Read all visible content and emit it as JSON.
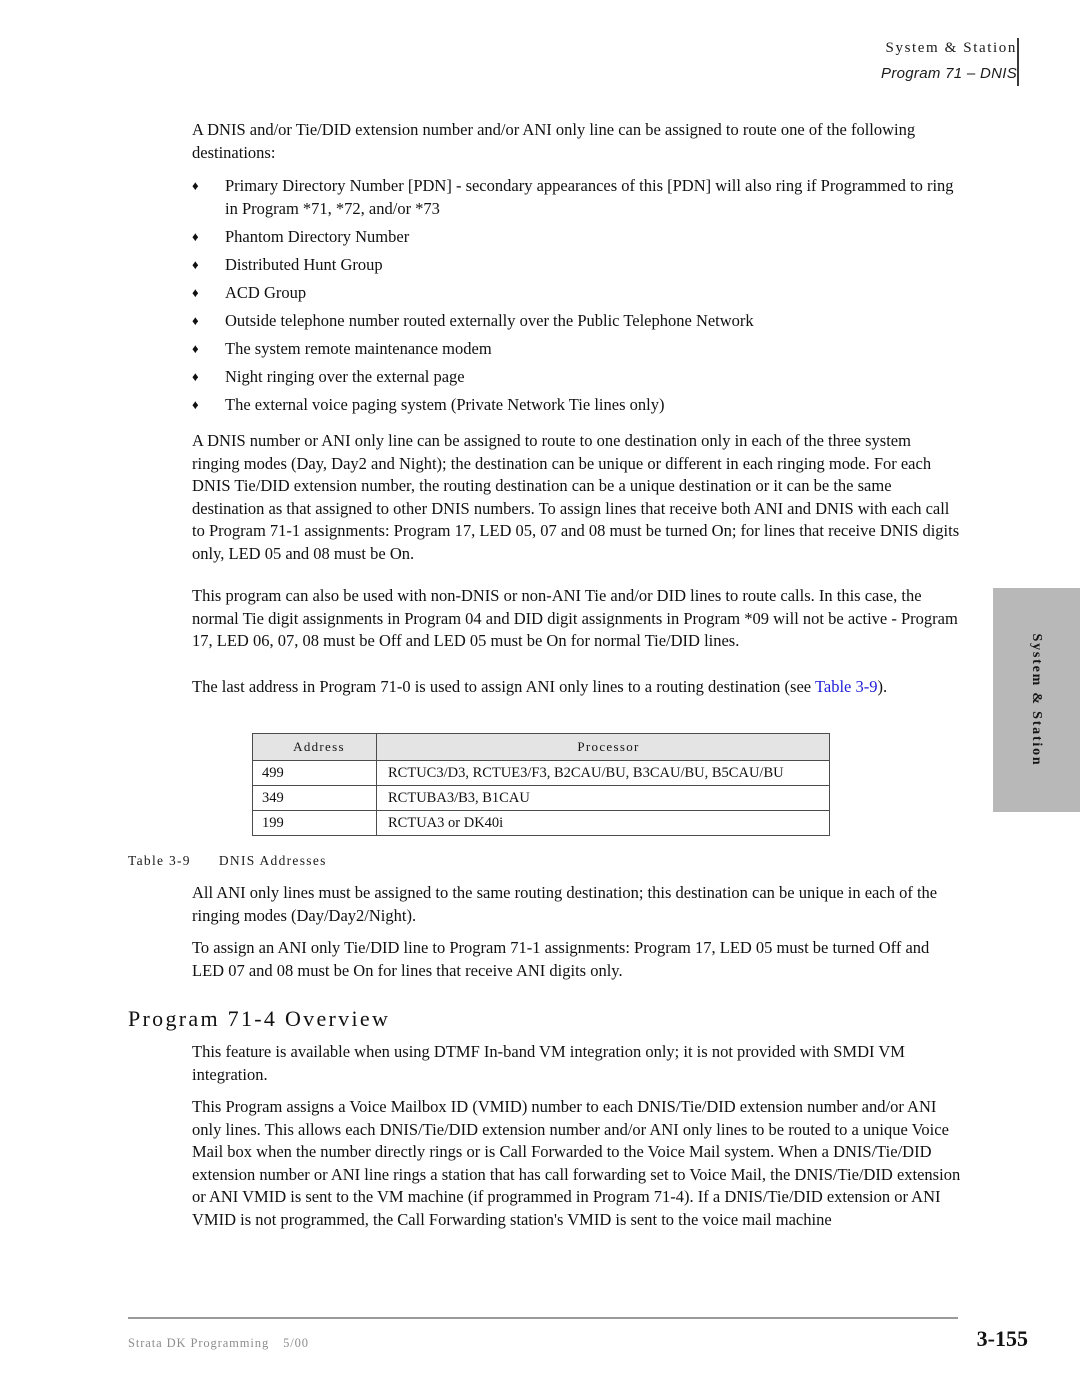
{
  "header": {
    "line1": "System & Station",
    "line2": "Program 71 – DNIS"
  },
  "side_tab": {
    "label": "System & Station"
  },
  "intro": {
    "text": "A DNIS and/or Tie/DID extension number and/or ANI only line can be assigned to route one of the following destinations:"
  },
  "bullets": [
    {
      "marker": "♦",
      "text": "Primary Directory Number [PDN] - secondary appearances of this [PDN] will also ring if Programmed to ring in Program *71, *72, and/or *73"
    },
    {
      "marker": "♦",
      "text": "Phantom Directory Number"
    },
    {
      "marker": "♦",
      "text": "Distributed Hunt Group"
    },
    {
      "marker": "♦",
      "text": "ACD Group"
    },
    {
      "marker": "♦",
      "text": "Outside telephone number routed externally over the Public Telephone Network"
    },
    {
      "marker": "♦",
      "text": "The system remote maintenance modem"
    },
    {
      "marker": "♦",
      "text": "Night ringing over the external page"
    },
    {
      "marker": "♦",
      "text": "The external voice paging system (Private Network Tie lines only)"
    }
  ],
  "paragraphs": {
    "p1": "A DNIS number or ANI only line can be assigned to route to one destination only in each of the three system ringing modes (Day, Day2 and Night); the destination can be unique or different in each ringing mode. For each DNIS Tie/DID extension number, the routing destination can be a unique destination or it can be the same destination as that assigned to other DNIS numbers. To assign lines that receive both ANI and DNIS with each call to Program 71-1 assignments: Program 17, LED 05, 07 and 08 must be turned On; for lines that receive DNIS digits only, LED 05 and 08 must be On.",
    "p2": "This program can also be used with non-DNIS or non-ANI Tie and/or DID lines to route calls. In this case, the normal Tie digit assignments in Program 04 and DID digit assignments in Program *09 will not be active - Program 17, LED 06, 07, 08 must be Off and LED 05 must be On for normal Tie/DID lines.",
    "p3_prefix": "The last address in Program 71-0 is used to assign ANI only lines to a routing destination (see ",
    "p3_link": "Table 3-9",
    "p3_suffix": ").",
    "p4": "All ANI only lines must be assigned to the same routing destination; this destination can be unique in each of the ringing modes (Day/Day2/Night).",
    "p5": "To assign an ANI only Tie/DID line to Program 71-1 assignments: Program 17, LED 05 must be turned Off and LED 07 and 08 must be On for lines that receive ANI digits only.",
    "p6": "This feature is available when using DTMF In-band VM integration only; it is not provided with SMDI VM integration.",
    "p7": "This Program assigns a Voice Mailbox ID (VMID) number to each DNIS/Tie/DID extension number and/or ANI only lines. This allows each DNIS/Tie/DID extension number and/or ANI only lines to be routed to a unique Voice Mail box when the number directly rings or is Call Forwarded to the Voice Mail system. When a DNIS/Tie/DID extension number or ANI line rings a station that has call forwarding set to Voice Mail, the DNIS/Tie/DID extension or ANI VMID is sent to the VM machine (if programmed in Program 71-4). If a DNIS/Tie/DID extension or ANI VMID is not programmed, the Call Forwarding station's VMID is sent to the voice mail machine"
  },
  "table": {
    "columns": [
      "Address",
      "Processor"
    ],
    "rows": [
      {
        "address": "499",
        "processor": "RCTUC3/D3, RCTUE3/F3, B2CAU/BU, B3CAU/BU, B5CAU/BU"
      },
      {
        "address": "349",
        "processor": "RCTUBA3/B3, B1CAU"
      },
      {
        "address": "199",
        "processor": "RCTUA3 or DK40i"
      }
    ],
    "caption_number": "Table 3-9",
    "caption_title": "DNIS Addresses"
  },
  "section_heading": {
    "program_71_4": "Program 71-4 Overview"
  },
  "footer": {
    "manual": "Strata DK Programming",
    "date": "5/00",
    "page": "3-155"
  },
  "colors": {
    "link": "#2020d8",
    "tab_fill": "#b8b8b8",
    "table_header_fill": "#e4e4e4",
    "footer_text": "#8d8d8d"
  }
}
